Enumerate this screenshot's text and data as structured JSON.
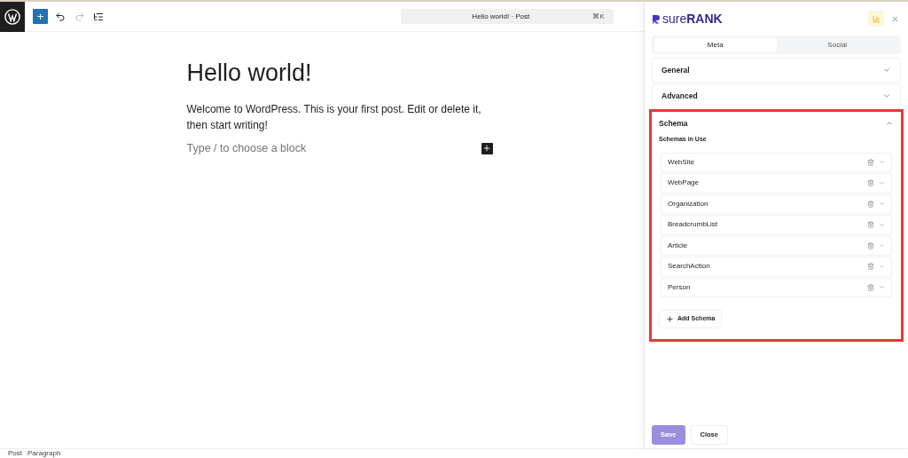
{
  "toolbar": {
    "add_button": {
      "label": "+"
    },
    "document_bar": {
      "title": "Hello world! · Post",
      "shortcut": "⌘K"
    }
  },
  "editor": {
    "title": "Hello world!",
    "paragraph": "Welcome to WordPress. This is your first post. Edit or delete it, then start writing!",
    "placeholder": "Type / to choose a block"
  },
  "breadcrumb": [
    "Post",
    "Paragraph"
  ],
  "sidebar": {
    "logo": "sure**RANK**",
    "tabs": [
      {
        "label": "Meta",
        "selected": true
      },
      {
        "label": "Social",
        "selected": false
      }
    ],
    "sections": [
      {
        "title": "General",
        "expanded": false,
        "highlighted": false
      },
      {
        "title": "Advanced",
        "expanded": false,
        "highlighted": false
      },
      {
        "title": "Schema",
        "expanded": true,
        "highlighted": true
      }
    ],
    "schemas_heading": "Schemas in Use",
    "schemas": [
      "WebSite",
      "WebPage",
      "Organization",
      "BreadcrumbList",
      "Article",
      "SearchAction",
      "Person"
    ],
    "add_schema": "Add Schema",
    "buttons": [
      {
        "label": "Save",
        "kind": "primary",
        "disabled": true
      },
      {
        "label": "Close",
        "kind": "secondary",
        "disabled": false
      }
    ]
  }
}
